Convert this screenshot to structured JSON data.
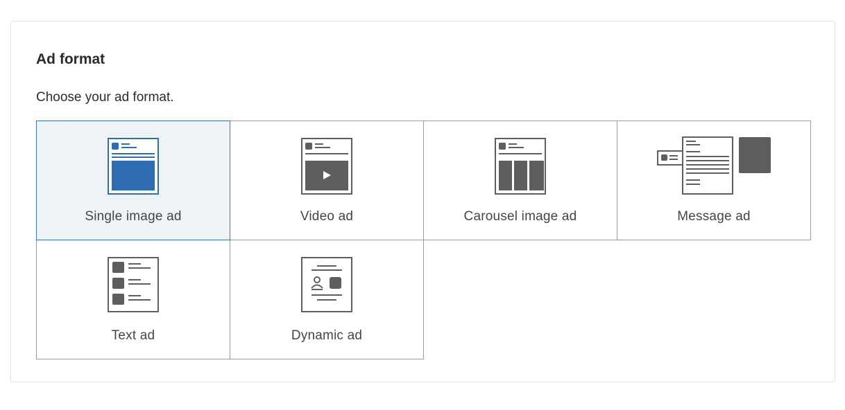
{
  "section": {
    "title": "Ad format",
    "subtitle": "Choose your ad format."
  },
  "formats": [
    {
      "label": "Single image ad",
      "icon": "single-image-icon",
      "selected": true
    },
    {
      "label": "Video ad",
      "icon": "video-icon",
      "selected": false
    },
    {
      "label": "Carousel image ad",
      "icon": "carousel-icon",
      "selected": false
    },
    {
      "label": "Message ad",
      "icon": "message-icon",
      "selected": false
    },
    {
      "label": "Text ad",
      "icon": "text-ad-icon",
      "selected": false
    },
    {
      "label": "Dynamic ad",
      "icon": "dynamic-ad-icon",
      "selected": false
    }
  ],
  "colors": {
    "selected_fill": "#2e6db4",
    "selected_background": "#eef3f8",
    "selected_border": "#3b73b9",
    "icon_gray": "#5e5e5e"
  }
}
